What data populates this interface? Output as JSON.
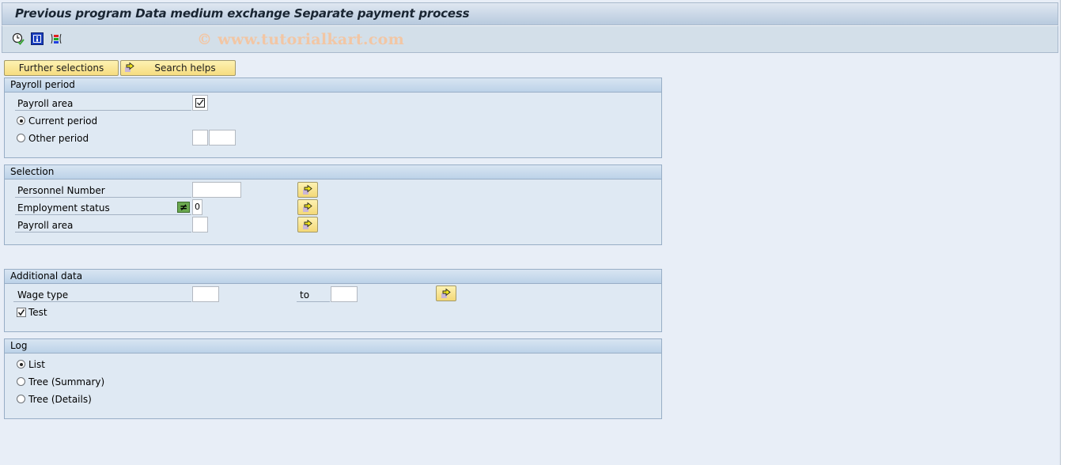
{
  "window": {
    "title": "Previous program Data medium exchange Separate payment process",
    "watermark": "© www.tutorialkart.com"
  },
  "toolbar": {
    "icons": [
      "execute-clock-icon",
      "info-icon",
      "selection-options-icon"
    ]
  },
  "buttons": {
    "further_selections": "Further selections",
    "search_helps": "Search helps"
  },
  "payroll_period": {
    "title": "Payroll period",
    "payroll_area_label": "Payroll area",
    "payroll_area_checked": true,
    "current_period_label": "Current period",
    "other_period_label": "Other period",
    "selected": "current",
    "other_period_value_1": "",
    "other_period_value_2": ""
  },
  "selection": {
    "title": "Selection",
    "personnel_number_label": "Personnel Number",
    "personnel_number_value": "",
    "employment_status_label": "Employment status",
    "employment_status_option": "≠",
    "employment_status_value": "0",
    "payroll_area_label": "Payroll area",
    "payroll_area_value": ""
  },
  "additional_data": {
    "title": "Additional data",
    "wage_type_label": "Wage type",
    "wage_type_from": "",
    "to_label": "to",
    "wage_type_to": "",
    "test_label": "Test",
    "test_checked": true
  },
  "log": {
    "title": "Log",
    "options": [
      "List",
      "Tree (Summary)",
      "Tree (Details)"
    ],
    "selected": "List"
  }
}
